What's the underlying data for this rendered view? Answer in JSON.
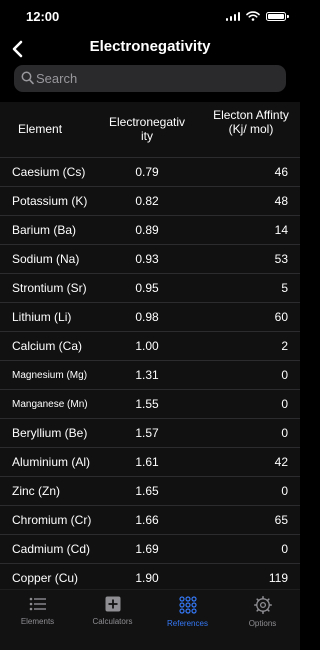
{
  "status": {
    "time": "12:00"
  },
  "nav": {
    "title": "Electronegativity"
  },
  "search": {
    "placeholder": "Search"
  },
  "table": {
    "headers": {
      "element": "Element",
      "electronegativity": "Electronegativ ity",
      "affinity": "Electon Affinty (Kj/ mol)"
    },
    "rows": [
      {
        "element": "Caesium (Cs)",
        "en": "0.79",
        "ea": "46"
      },
      {
        "element": "Potassium (K)",
        "en": "0.82",
        "ea": "48"
      },
      {
        "element": "Barium (Ba)",
        "en": "0.89",
        "ea": "14"
      },
      {
        "element": "Sodium (Na)",
        "en": "0.93",
        "ea": "53"
      },
      {
        "element": "Strontium (Sr)",
        "en": "0.95",
        "ea": "5"
      },
      {
        "element": "Lithium (Li)",
        "en": "0.98",
        "ea": "60"
      },
      {
        "element": "Calcium (Ca)",
        "en": "1.00",
        "ea": "2"
      },
      {
        "element": "Magnesium (Mg)",
        "en": "1.31",
        "ea": "0"
      },
      {
        "element": "Manganese (Mn)",
        "en": "1.55",
        "ea": "0"
      },
      {
        "element": "Beryllium (Be)",
        "en": "1.57",
        "ea": "0"
      },
      {
        "element": "Aluminium (Al)",
        "en": "1.61",
        "ea": "42"
      },
      {
        "element": "Zinc (Zn)",
        "en": "1.65",
        "ea": "0"
      },
      {
        "element": "Chromium (Cr)",
        "en": "1.66",
        "ea": "65"
      },
      {
        "element": "Cadmium (Cd)",
        "en": "1.69",
        "ea": "0"
      },
      {
        "element": "Copper (Cu)",
        "en": "1.90",
        "ea": "119"
      }
    ]
  },
  "tabs": [
    {
      "label": "Elements",
      "icon": "list-icon"
    },
    {
      "label": "Calculators",
      "icon": "calculator-icon"
    },
    {
      "label": "References",
      "icon": "grid-icon",
      "active": true
    },
    {
      "label": "Options",
      "icon": "gear-icon"
    }
  ],
  "colors": {
    "accent": "#3478f6",
    "background": "#000000",
    "table_bg": "#111111",
    "inactive": "#8e8e93"
  }
}
